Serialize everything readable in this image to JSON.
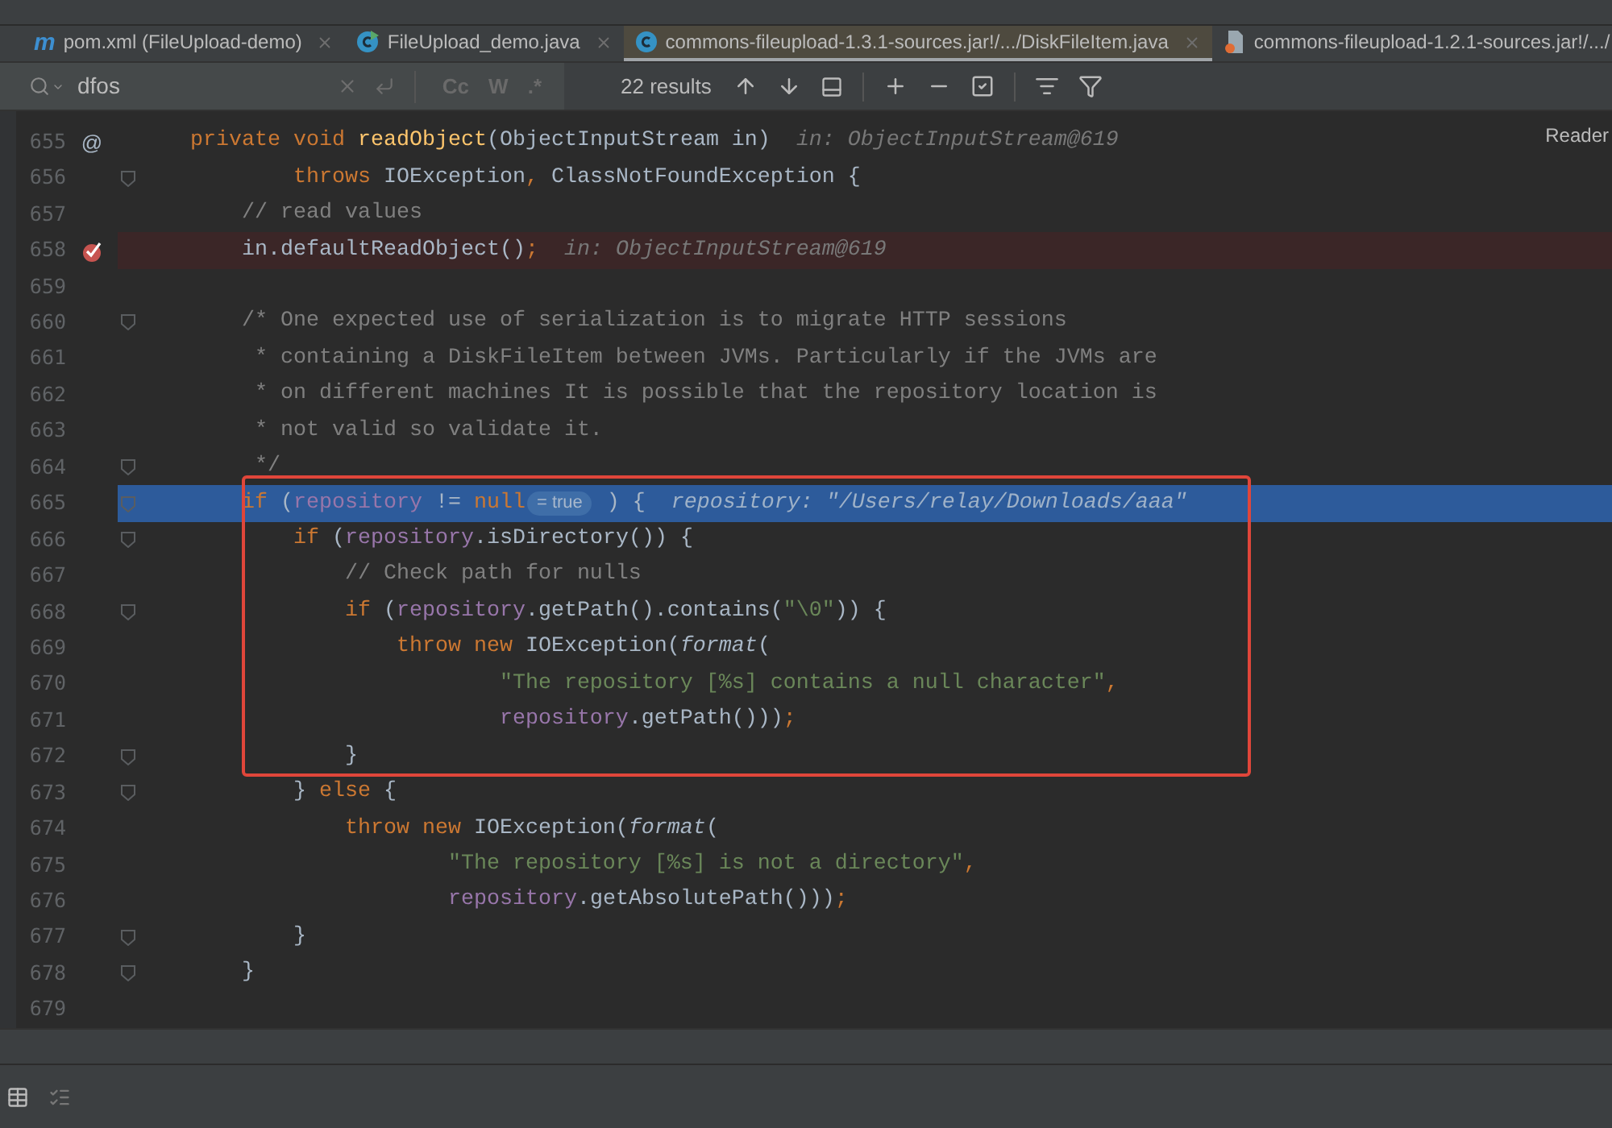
{
  "tabs": [
    {
      "kind": "maven",
      "icon_glyph": "m",
      "label": "pom.xml (FileUpload-demo)",
      "closable": true,
      "selected": false
    },
    {
      "kind": "runnable-class",
      "label": "FileUpload_demo.java",
      "closable": true,
      "selected": false
    },
    {
      "kind": "class",
      "label": "commons-fileupload-1.3.1-sources.jar!/.../DiskFileItem.java",
      "closable": true,
      "selected": true
    },
    {
      "kind": "jar",
      "label": "commons-fileupload-1.2.1-sources.jar!/.../",
      "closable": false,
      "selected": false
    }
  ],
  "search": {
    "value": "dfos",
    "toggles": [
      {
        "label": "Cc",
        "selected": false
      },
      {
        "label": "W",
        "selected": false
      },
      {
        "label": ".*",
        "selected": false
      }
    ],
    "results": "22 results"
  },
  "reader_mode": "Reader",
  "code_lines": [
    {
      "number": "655",
      "gutter_glyph": "@",
      "fold": false,
      "breakpoint": false,
      "current": false,
      "tokens": [
        {
          "kind": "kw",
          "text": "    private void "
        },
        {
          "kind": "fn",
          "text": "readObject"
        },
        {
          "kind": "txt",
          "text": "(ObjectInputStream in)"
        }
      ],
      "hint": "in: ObjectInputStream@619"
    },
    {
      "number": "656",
      "fold": true,
      "breakpoint": false,
      "current": false,
      "tokens": [
        {
          "kind": "kw",
          "text": "            throws "
        },
        {
          "kind": "txt",
          "text": "IOException"
        },
        {
          "kind": "kw",
          "text": ", "
        },
        {
          "kind": "txt",
          "text": "ClassNotFoundException {"
        }
      ]
    },
    {
      "number": "657",
      "fold": false,
      "breakpoint": false,
      "current": false,
      "tokens": [
        {
          "kind": "com",
          "text": "        // read values"
        }
      ]
    },
    {
      "number": "658",
      "fold": false,
      "breakpoint": true,
      "current": false,
      "tokens": [
        {
          "kind": "txt",
          "text": "        in.defaultReadObject()"
        },
        {
          "kind": "kw",
          "text": ";"
        }
      ],
      "hint": "in: ObjectInputStream@619"
    },
    {
      "number": "659",
      "fold": false,
      "breakpoint": false,
      "current": false
    },
    {
      "number": "660",
      "fold": true,
      "breakpoint": false,
      "current": false,
      "tokens": [
        {
          "kind": "com",
          "text": "        /* One expected use of serialization is to migrate HTTP sessions"
        }
      ]
    },
    {
      "number": "661",
      "fold": false,
      "breakpoint": false,
      "current": false,
      "tokens": [
        {
          "kind": "com",
          "text": "         * containing a DiskFileItem between JVMs. Particularly if the JVMs are"
        }
      ]
    },
    {
      "number": "662",
      "fold": false,
      "breakpoint": false,
      "current": false,
      "tokens": [
        {
          "kind": "com",
          "text": "         * on different machines It is possible that the repository location is"
        }
      ]
    },
    {
      "number": "663",
      "fold": false,
      "breakpoint": false,
      "current": false,
      "tokens": [
        {
          "kind": "com",
          "text": "         * not valid so validate it."
        }
      ]
    },
    {
      "number": "664",
      "fold": true,
      "breakpoint": false,
      "current": false,
      "tokens": [
        {
          "kind": "com",
          "text": "         */"
        }
      ]
    },
    {
      "number": "665",
      "fold": true,
      "breakpoint": false,
      "current": true,
      "tokens": [
        {
          "kind": "kw",
          "text": "        if"
        },
        {
          "kind": "txt",
          "text": " ("
        },
        {
          "kind": "field",
          "text": "repository"
        },
        {
          "kind": "txt",
          "text": " != "
        },
        {
          "kind": "kw",
          "text": "null"
        }
      ],
      "badge": "= true",
      "tokens_after": [
        {
          "kind": "txt",
          "text": " ) {"
        }
      ],
      "hint": "repository: \"/Users/relay/Downloads/aaa\""
    },
    {
      "number": "666",
      "fold": true,
      "breakpoint": false,
      "current": false,
      "tokens": [
        {
          "kind": "kw",
          "text": "            if"
        },
        {
          "kind": "txt",
          "text": " ("
        },
        {
          "kind": "field",
          "text": "repository"
        },
        {
          "kind": "txt",
          "text": ".isDirectory()) {"
        }
      ]
    },
    {
      "number": "667",
      "fold": false,
      "breakpoint": false,
      "current": false,
      "tokens": [
        {
          "kind": "com",
          "text": "                // Check path for nulls"
        }
      ]
    },
    {
      "number": "668",
      "fold": true,
      "breakpoint": false,
      "current": false,
      "tokens": [
        {
          "kind": "kw",
          "text": "                if"
        },
        {
          "kind": "txt",
          "text": " ("
        },
        {
          "kind": "field",
          "text": "repository"
        },
        {
          "kind": "txt",
          "text": ".getPath().contains("
        },
        {
          "kind": "str",
          "text": "\"\\0\""
        },
        {
          "kind": "txt",
          "text": ")) {"
        }
      ]
    },
    {
      "number": "669",
      "fold": false,
      "breakpoint": false,
      "current": false,
      "tokens": [
        {
          "kind": "kw",
          "text": "                    throw new "
        },
        {
          "kind": "txt",
          "text": "IOException("
        },
        {
          "kind": "it",
          "text": "format"
        },
        {
          "kind": "txt",
          "text": "("
        }
      ]
    },
    {
      "number": "670",
      "fold": false,
      "breakpoint": false,
      "current": false,
      "tokens": [
        {
          "kind": "str",
          "text": "                            \"The repository [%s] contains a null character\""
        },
        {
          "kind": "kw",
          "text": ","
        }
      ]
    },
    {
      "number": "671",
      "fold": false,
      "breakpoint": false,
      "current": false,
      "tokens": [
        {
          "kind": "field",
          "text": "                            repository"
        },
        {
          "kind": "txt",
          "text": ".getPath()))"
        },
        {
          "kind": "kw",
          "text": ";"
        }
      ]
    },
    {
      "number": "672",
      "fold": true,
      "breakpoint": false,
      "current": false,
      "tokens": [
        {
          "kind": "txt",
          "text": "                }"
        }
      ]
    },
    {
      "number": "673",
      "fold": true,
      "breakpoint": false,
      "current": false,
      "tokens": [
        {
          "kind": "txt",
          "text": "            } "
        },
        {
          "kind": "kw",
          "text": "else"
        },
        {
          "kind": "txt",
          "text": " {"
        }
      ]
    },
    {
      "number": "674",
      "fold": false,
      "breakpoint": false,
      "current": false,
      "tokens": [
        {
          "kind": "kw",
          "text": "                throw new "
        },
        {
          "kind": "txt",
          "text": "IOException("
        },
        {
          "kind": "it",
          "text": "format"
        },
        {
          "kind": "txt",
          "text": "("
        }
      ]
    },
    {
      "number": "675",
      "fold": false,
      "breakpoint": false,
      "current": false,
      "tokens": [
        {
          "kind": "str",
          "text": "                        \"The repository [%s] is not a directory\""
        },
        {
          "kind": "kw",
          "text": ","
        }
      ]
    },
    {
      "number": "676",
      "fold": false,
      "breakpoint": false,
      "current": false,
      "tokens": [
        {
          "kind": "field",
          "text": "                        repository"
        },
        {
          "kind": "txt",
          "text": ".getAbsolutePath()))"
        },
        {
          "kind": "kw",
          "text": ";"
        }
      ]
    },
    {
      "number": "677",
      "fold": true,
      "breakpoint": false,
      "current": false,
      "tokens": [
        {
          "kind": "txt",
          "text": "            }"
        }
      ]
    },
    {
      "number": "678",
      "fold": true,
      "breakpoint": false,
      "current": false,
      "tokens": [
        {
          "kind": "txt",
          "text": "        }"
        }
      ]
    },
    {
      "number": "679",
      "fold": false,
      "breakpoint": false,
      "current": false
    }
  ]
}
